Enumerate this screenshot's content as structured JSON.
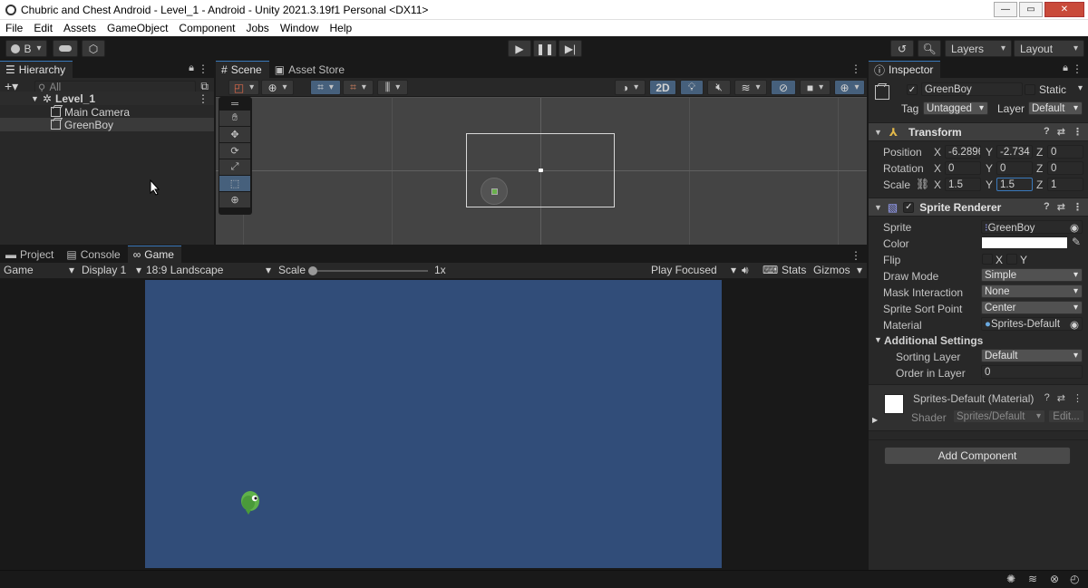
{
  "window": {
    "title": "Chubric and Chest Android - Level_1 - Android - Unity 2021.3.19f1 Personal <DX11>",
    "minimize": "—",
    "maximize": "▭",
    "close": "✕"
  },
  "menu": [
    "File",
    "Edit",
    "Assets",
    "GameObject",
    "Component",
    "Jobs",
    "Window",
    "Help"
  ],
  "toolbar": {
    "account": "B",
    "layers": "Layers",
    "layout": "Layout"
  },
  "hierarchy": {
    "tab": "Hierarchy",
    "search_placeholder": "All",
    "scene": "Level_1",
    "items": [
      "Main Camera",
      "GreenBoy"
    ]
  },
  "scene": {
    "tab_scene": "Scene",
    "tab_asset_store": "Asset Store",
    "mode_2d": "2D"
  },
  "bottom_tabs": {
    "project": "Project",
    "console": "Console",
    "game": "Game"
  },
  "game": {
    "view_mode": "Game",
    "display": "Display 1",
    "aspect": "18:9 Landscape",
    "scale_label": "Scale",
    "scale_value": "1x",
    "play_mode": "Play Focused",
    "stats": "Stats",
    "gizmos": "Gizmos",
    "background": "#314d79"
  },
  "inspector": {
    "tab": "Inspector",
    "object_name": "GreenBoy",
    "static_label": "Static",
    "tag_label": "Tag",
    "tag_value": "Untagged",
    "layer_label": "Layer",
    "layer_value": "Default",
    "transform": {
      "title": "Transform",
      "position_label": "Position",
      "rotation_label": "Rotation",
      "scale_label": "Scale",
      "position": {
        "x": "-6.2896",
        "y": "-2.734",
        "z": "0"
      },
      "rotation": {
        "x": "0",
        "y": "0",
        "z": "0"
      },
      "scale": {
        "x": "1.5",
        "y": "1.5",
        "z": "1"
      }
    },
    "sprite_renderer": {
      "title": "Sprite Renderer",
      "sprite_label": "Sprite",
      "sprite_value": "GreenBoy",
      "color_label": "Color",
      "flip_label": "Flip",
      "flip_x": "X",
      "flip_y": "Y",
      "draw_mode_label": "Draw Mode",
      "draw_mode_value": "Simple",
      "mask_label": "Mask Interaction",
      "mask_value": "None",
      "sort_point_label": "Sprite Sort Point",
      "sort_point_value": "Center",
      "material_label": "Material",
      "material_value": "Sprites-Default",
      "additional": "Additional Settings",
      "sorting_layer_label": "Sorting Layer",
      "sorting_layer_value": "Default",
      "order_label": "Order in Layer",
      "order_value": "0"
    },
    "material": {
      "title": "Sprites-Default (Material)",
      "shader_label": "Shader",
      "shader_value": "Sprites/Default",
      "edit": "Edit..."
    },
    "add_component": "Add Component"
  }
}
